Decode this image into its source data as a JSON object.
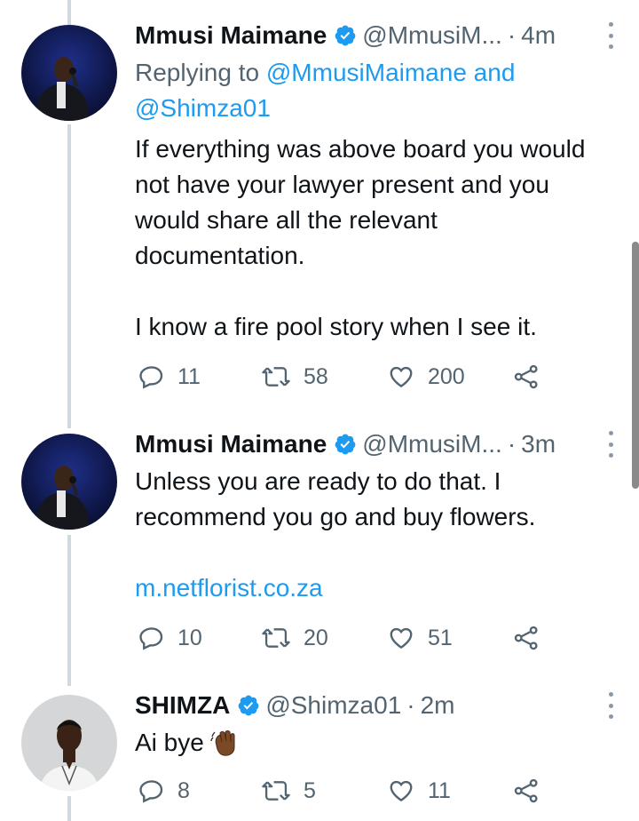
{
  "tweets": [
    {
      "name": "Mmusi Maimane",
      "handle": "@MmusiM...",
      "time": "4m",
      "replying_prefix": "Replying to ",
      "replying_mention1": "@MmusiMaimane",
      "replying_and": " and",
      "replying_mention2": "@Shimza01",
      "text": "If everything was above board you would\nnot have your lawyer present and you\nwould share all the relevant\ndocumentation.\n\nI know a fire pool story when I see it.",
      "replies": "11",
      "retweets": "58",
      "likes": "200"
    },
    {
      "name": "Mmusi Maimane",
      "handle": "@MmusiM...",
      "time": "3m",
      "text": "Unless you are ready to do that. I\nrecommend you go and buy flowers.",
      "link": "m.netflorist.co.za",
      "replies": "10",
      "retweets": "20",
      "likes": "51"
    },
    {
      "name": "SHIMZA",
      "handle": "@Shimza01",
      "time": "2m",
      "text": "Ai bye",
      "emoji": "waving-hand-emoji-dark-skin",
      "replies": "8",
      "retweets": "5",
      "likes": "11"
    }
  ],
  "colors": {
    "verified": "#1d9bf0",
    "link": "#1d9bf0",
    "secondary": "#536471",
    "thread_line": "#cfd9de"
  },
  "icons": [
    "reply-icon",
    "retweet-icon",
    "like-icon",
    "share-icon",
    "verified-badge-icon",
    "more-icon"
  ]
}
